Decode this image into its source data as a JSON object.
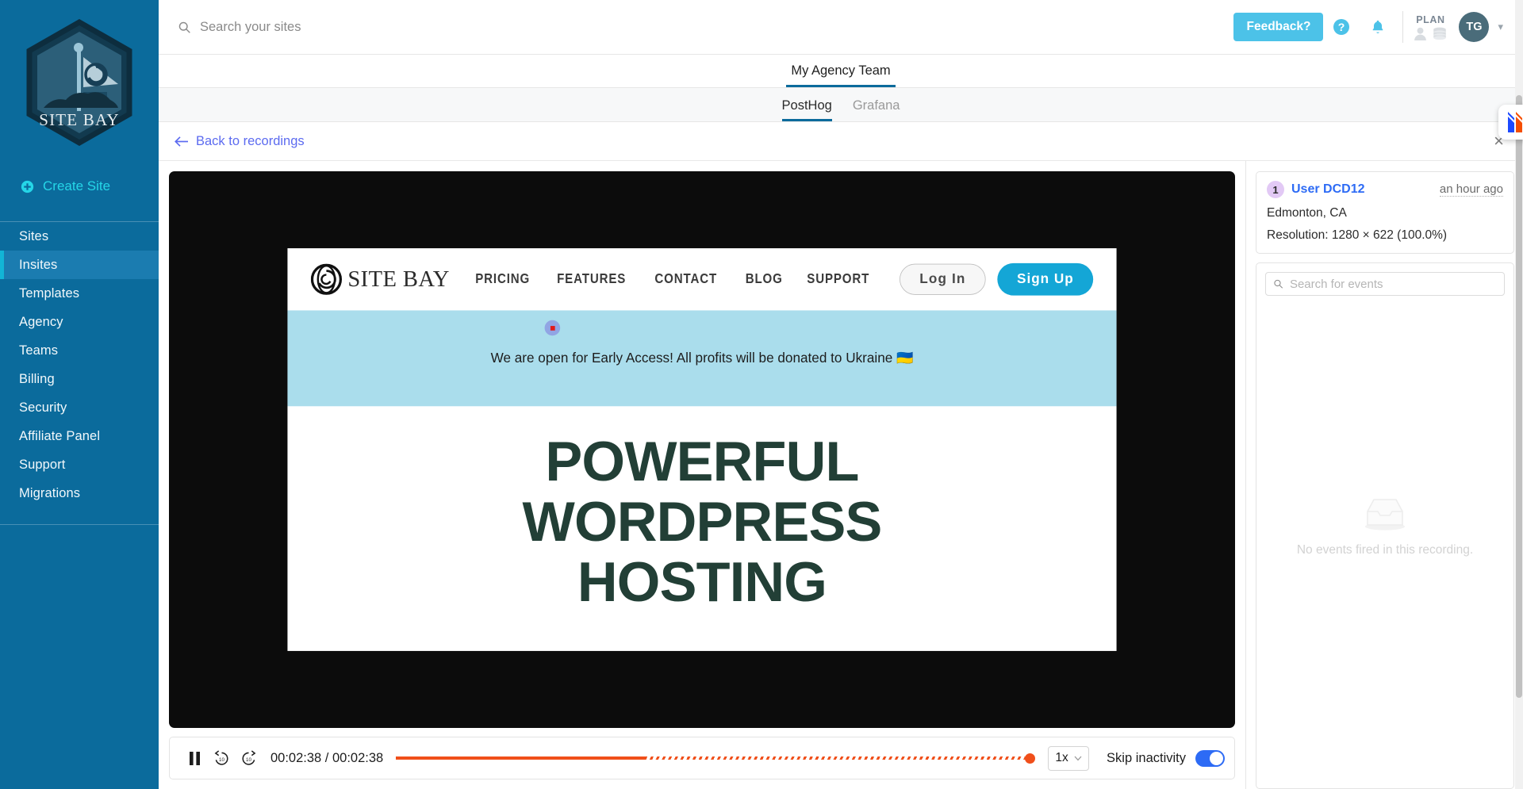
{
  "sidebar": {
    "logo_text": "SITE BAY",
    "create_site_label": "Create Site",
    "items": [
      {
        "label": "Sites",
        "active": false
      },
      {
        "label": "Insites",
        "active": true
      },
      {
        "label": "Templates",
        "active": false
      },
      {
        "label": "Agency",
        "active": false
      },
      {
        "label": "Teams",
        "active": false
      },
      {
        "label": "Billing",
        "active": false
      },
      {
        "label": "Security",
        "active": false
      },
      {
        "label": "Affiliate Panel",
        "active": false
      },
      {
        "label": "Support",
        "active": false
      },
      {
        "label": "Migrations",
        "active": false
      }
    ],
    "bg_color": "#0b6b9c",
    "active_bg_color": "#1b7cb0",
    "accent_color": "#25d6e8"
  },
  "topbar": {
    "search_placeholder": "Search your sites",
    "feedback_label": "Feedback?",
    "feedback_color": "#4cc2e8",
    "plan_label": "PLAN",
    "avatar_initials": "TG"
  },
  "tabs": {
    "team_tab": "My Agency Team",
    "sub_tabs": [
      {
        "label": "PostHog",
        "active": true
      },
      {
        "label": "Grafana",
        "active": false
      }
    ],
    "active_underline_color": "#0b6b9c"
  },
  "subheader": {
    "back_label": "Back to recordings",
    "back_color": "#5c6bf0",
    "close_label": "×"
  },
  "recording": {
    "site": {
      "logo_text": "SITE BAY",
      "menu": [
        "PRICING",
        "FEATURES",
        "CONTACT",
        "BLOG",
        "SUPPORT"
      ],
      "login_label": "Log In",
      "signup_label": "Sign Up",
      "signup_color": "#14a6d6",
      "banner_text": "We are open for Early Access! All profits will be donated to Ukraine 🇺🇦",
      "banner_color": "#aaddec",
      "hero_lines": [
        "POWERFUL",
        "WORDPRESS",
        "HOSTING"
      ],
      "hero_color": "#223f36"
    }
  },
  "player": {
    "play_state_icon": "pause-icon",
    "rewind_label": "10",
    "forward_label": "10",
    "current_time": "00:02:38",
    "total_time": "00:02:38",
    "timecode": "00:02:38 / 00:02:38",
    "progress_percent": 100,
    "active_segment_percent": 39,
    "progress_color": "#f04f1a",
    "speed": "1x",
    "skip_inactivity_label": "Skip inactivity",
    "skip_inactivity_on": true,
    "toggle_on_color": "#2d6bf5"
  },
  "right_panel": {
    "user": {
      "badge": "1",
      "name": "User DCD12",
      "time_ago": "an hour ago",
      "location": "Edmonton, CA",
      "resolution": "Resolution: 1280 × 622 (100.0%)",
      "name_color": "#2d6bf5"
    },
    "events": {
      "search_placeholder": "Search for events",
      "empty_text": "No events fired in this recording."
    }
  }
}
